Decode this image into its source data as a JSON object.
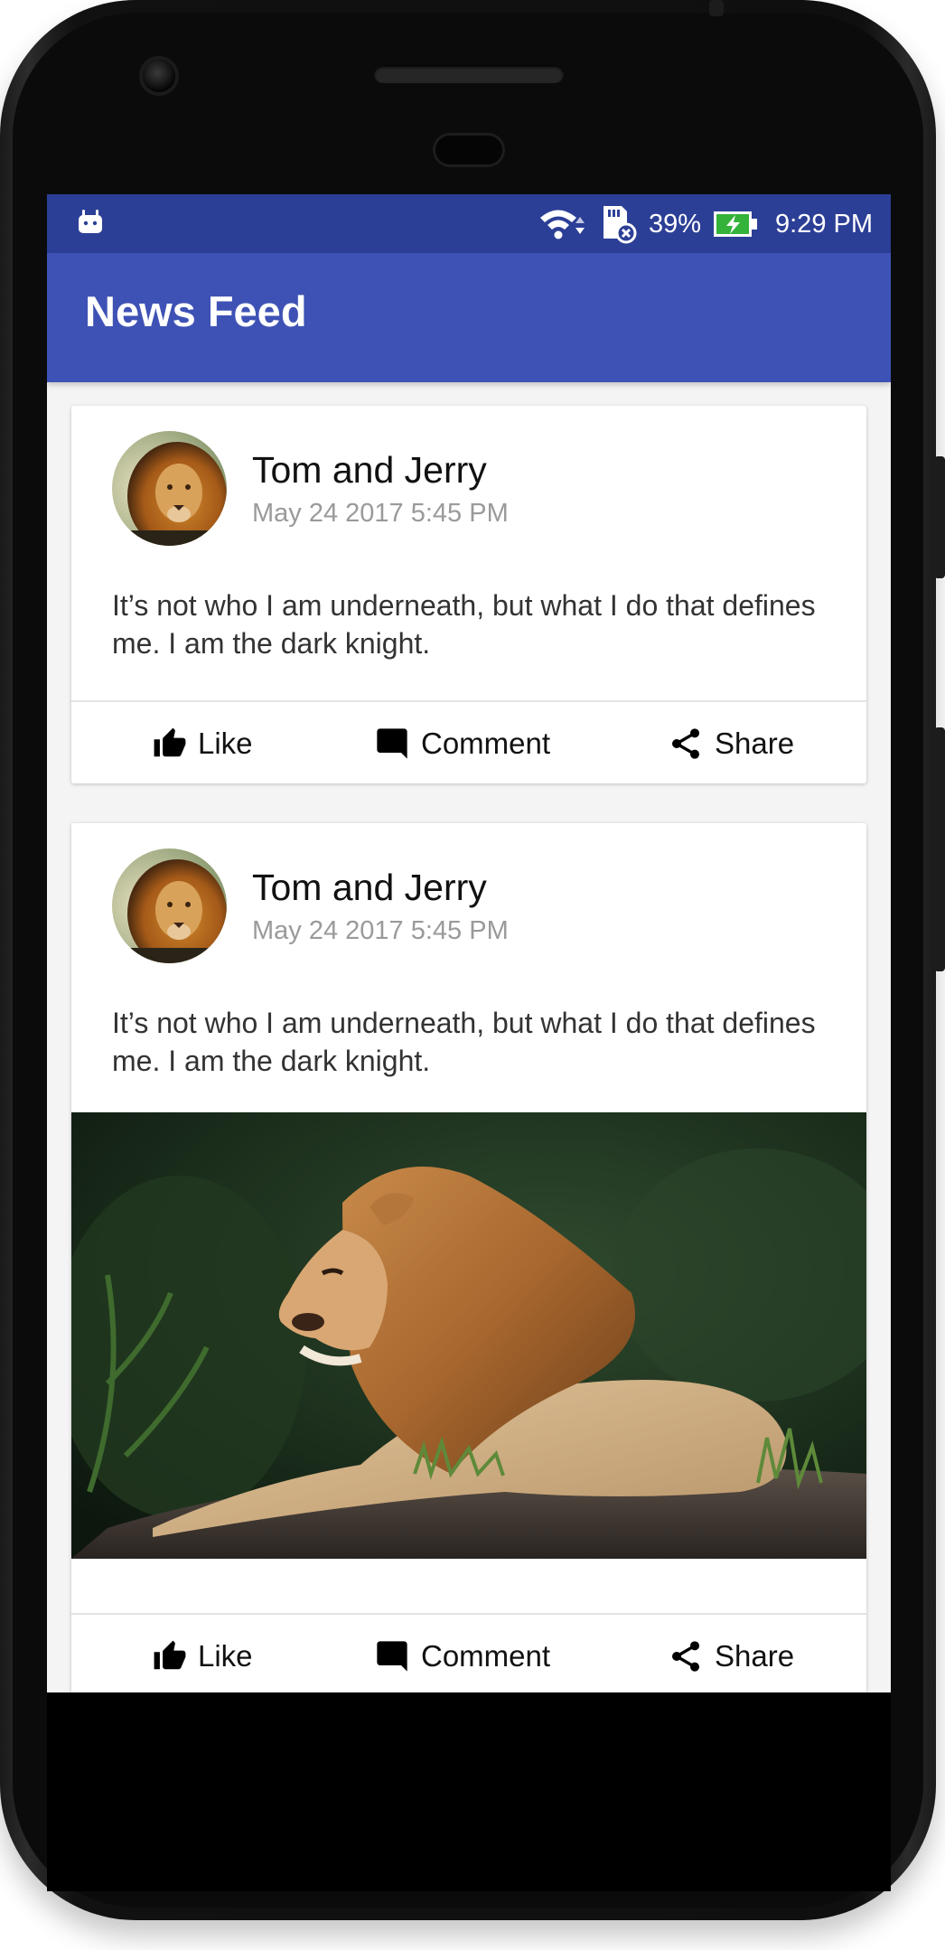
{
  "status_bar": {
    "battery_percent": "39%",
    "time": "9:29 PM",
    "icons": [
      "android-icon",
      "wifi-icon",
      "sd-card-icon",
      "battery-charging-icon"
    ],
    "color": "#2c3f96"
  },
  "app_bar": {
    "title": "News Feed",
    "color": "#3e52b5"
  },
  "posts": [
    {
      "author": "Tom and Jerry",
      "timestamp": "May 24 2017 5:45 PM",
      "text": "It’s not who I am underneath, but what I do that defines me. I am the dark knight.",
      "has_image": false,
      "actions": {
        "like": "Like",
        "comment": "Comment",
        "share": "Share"
      }
    },
    {
      "author": "Tom and Jerry",
      "timestamp": "May 24 2017 5:45 PM",
      "text": "It’s not who I am underneath, but what I do that defines me. I am the dark knight.",
      "has_image": true,
      "actions": {
        "like": "Like",
        "comment": "Comment",
        "share": "Share"
      }
    }
  ]
}
